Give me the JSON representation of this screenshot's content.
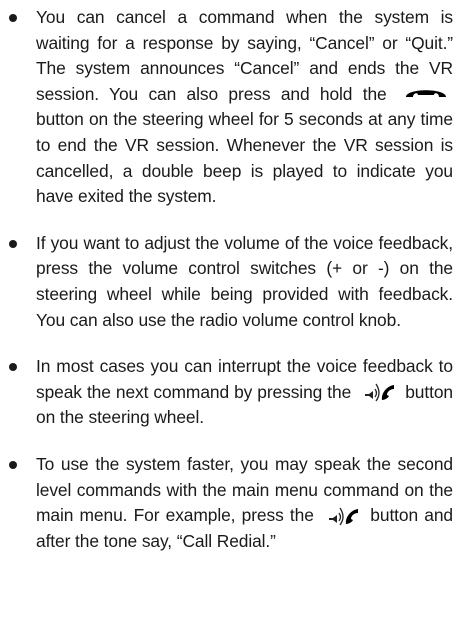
{
  "bullets": [
    {
      "part1": "You can cancel a command when the system is waiting for a response by saying, “Cancel” or “Quit.” The system announces “Cancel” and ends the VR session. You can also press and hold the",
      "icon": "phone-end-icon",
      "part2": "button on the steering wheel for 5 seconds at any time to end the VR session. Whenever the VR session is cancelled, a double beep is played to indicate you have exited the system."
    },
    {
      "text": "If you want to adjust the volume of the voice feedback, press the volume control switches (+ or -) on the steering wheel while being provided with feedback. You can also use the radio volume control knob."
    },
    {
      "part1": "In most cases you can interrupt the voice feedback to speak the next command by pressing the",
      "icon": "talk-icon",
      "part2": "button on the steering wheel."
    },
    {
      "part1": "To use the system faster, you may speak the second level commands with the main menu command on the main menu. For example, press the",
      "icon": "talk-icon",
      "part2": "button and after the tone say, “Call Redial.”"
    }
  ]
}
